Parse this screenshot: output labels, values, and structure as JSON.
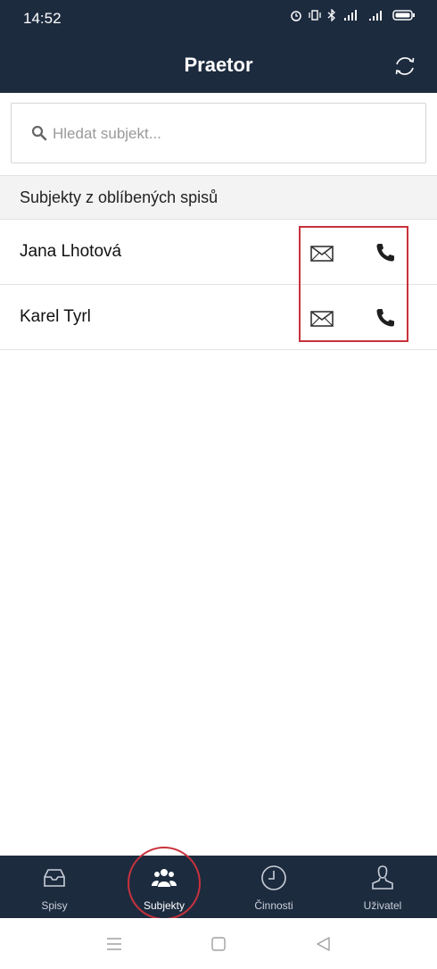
{
  "status_bar": {
    "time": "14:52",
    "icons": [
      "alarm-icon",
      "vibrate-icon",
      "bluetooth-icon",
      "wifi-icon",
      "signal-icon",
      "battery-icon"
    ]
  },
  "header": {
    "title": "Praetor",
    "refresh_icon": "refresh-icon"
  },
  "search": {
    "placeholder": "Hledat subjekt...",
    "value": ""
  },
  "section": {
    "title": "Subjekty z oblíbených spisů"
  },
  "contacts": [
    {
      "name": "Jana Lhotová"
    },
    {
      "name": "Karel Tyrl"
    }
  ],
  "tabs": [
    {
      "label": "Spisy",
      "icon": "inbox-icon",
      "active": false
    },
    {
      "label": "Subjekty",
      "icon": "people-icon",
      "active": true
    },
    {
      "label": "Činnosti",
      "icon": "clock-icon",
      "active": false
    },
    {
      "label": "Uživatel",
      "icon": "user-icon",
      "active": false
    }
  ],
  "system_nav": [
    "menu-icon",
    "home-icon",
    "back-icon"
  ],
  "colors": {
    "header_bg": "#1d2b3f",
    "highlight": "#c8323c",
    "section_bg": "#f3f3f3"
  }
}
